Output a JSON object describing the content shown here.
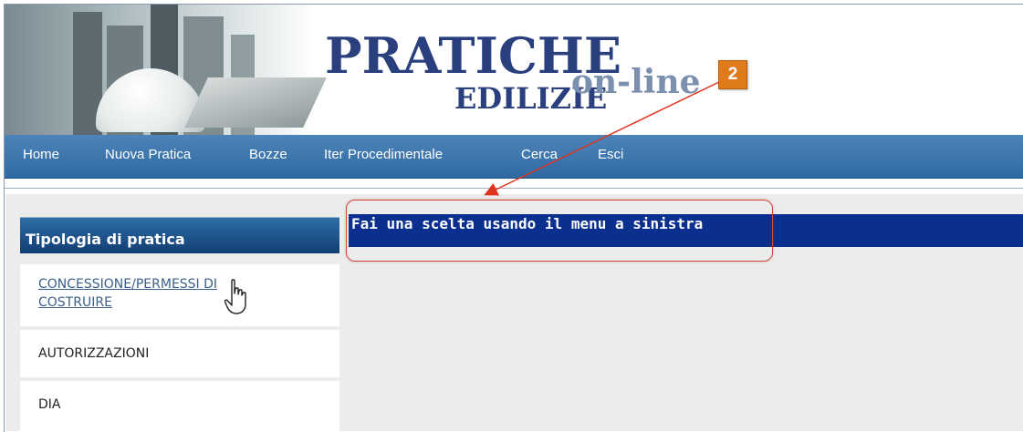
{
  "header": {
    "logo_main": "PRATICHE",
    "logo_sub": "EDILIZIE",
    "logo_online": "on-line",
    "step_badge": "2"
  },
  "nav": {
    "items": [
      {
        "label": "Home"
      },
      {
        "label": "Nuova Pratica"
      },
      {
        "label": "Bozze"
      },
      {
        "label": "Iter Procedimentale"
      },
      {
        "label": "Cerca"
      },
      {
        "label": "Esci"
      }
    ]
  },
  "sidebar": {
    "title": "Tipologia di pratica",
    "items": [
      {
        "label_line1": "CONCESSIONE/PERMESSI DI",
        "label_line2": "COSTRUIRE"
      },
      {
        "label": "AUTORIZZAZIONI"
      },
      {
        "label": "DIA"
      }
    ]
  },
  "main": {
    "message": "Fai una scelta usando il menu a sinistra"
  },
  "colors": {
    "nav_bg": "#3a75ae",
    "sidebar_head_bg": "#1f5390",
    "main_bar_bg": "#0b2f8e",
    "annotation_red": "#cc4a3a",
    "badge_orange": "#e07b1c"
  }
}
